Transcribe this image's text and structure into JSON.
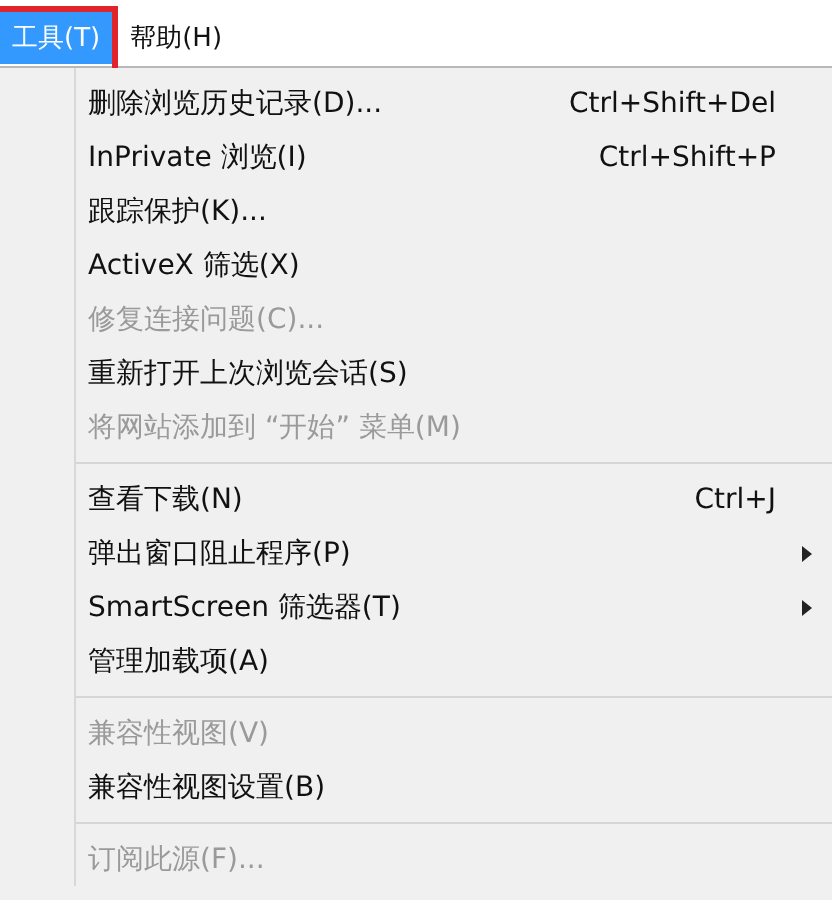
{
  "menubar": [
    {
      "label": "工具(T)",
      "selected": true,
      "annotated": true
    },
    {
      "label": "帮助(H)",
      "selected": false,
      "annotated": false
    }
  ],
  "menu": {
    "groups": [
      {
        "items": [
          {
            "label": "删除浏览历史记录(D)...",
            "shortcut": "Ctrl+Shift+Del",
            "kind": "command",
            "disabled": false
          },
          {
            "label": "InPrivate 浏览(I)",
            "shortcut": "Ctrl+Shift+P",
            "kind": "command",
            "disabled": false
          },
          {
            "label": "跟踪保护(K)...",
            "kind": "command",
            "disabled": false
          },
          {
            "label": "ActiveX 筛选(X)",
            "kind": "command",
            "disabled": false
          },
          {
            "label": "修复连接问题(C)...",
            "kind": "command",
            "disabled": true
          },
          {
            "label": "重新打开上次浏览会话(S)",
            "kind": "command",
            "disabled": false
          },
          {
            "label": "将网站添加到 “开始” 菜单(M)",
            "kind": "command",
            "disabled": true
          }
        ]
      },
      {
        "items": [
          {
            "label": "查看下载(N)",
            "shortcut": "Ctrl+J",
            "kind": "command",
            "disabled": false
          },
          {
            "label": "弹出窗口阻止程序(P)",
            "kind": "submenu",
            "disabled": false
          },
          {
            "label": "SmartScreen 筛选器(T)",
            "kind": "submenu",
            "disabled": false
          },
          {
            "label": "管理加载项(A)",
            "kind": "command",
            "disabled": false
          }
        ]
      },
      {
        "items": [
          {
            "label": "兼容性视图(V)",
            "kind": "command",
            "disabled": true
          },
          {
            "label": "兼容性视图设置(B)",
            "kind": "command",
            "disabled": false
          }
        ]
      },
      {
        "items": [
          {
            "label": "订阅此源(F)...",
            "kind": "command",
            "disabled": true
          }
        ]
      }
    ]
  }
}
